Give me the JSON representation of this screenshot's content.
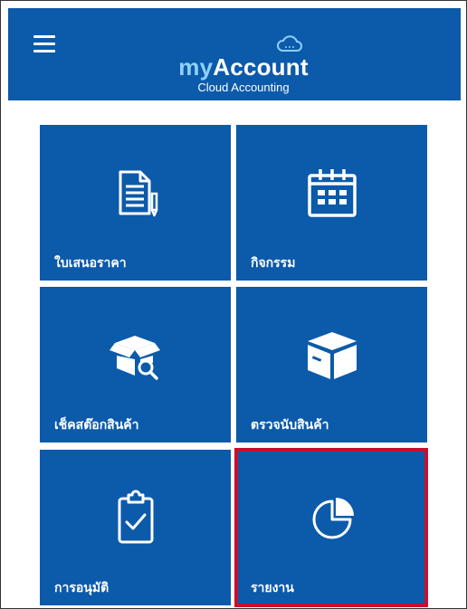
{
  "header": {
    "menu_icon": "hamburger-menu-icon",
    "logo_cloud_icon": "cloud-icon",
    "logo_prefix": "my",
    "logo_suffix": "Account",
    "logo_subtitle": "Cloud Accounting"
  },
  "tiles": [
    {
      "label": "ใบเสนอราคา",
      "icon": "document-edit-icon"
    },
    {
      "label": "กิจกรรม",
      "icon": "calendar-icon"
    },
    {
      "label": "เช็คสต๊อกสินค้า",
      "icon": "box-search-icon"
    },
    {
      "label": "ตรวจนับสินค้า",
      "icon": "box-icon"
    },
    {
      "label": "การอนุมัติ",
      "icon": "clipboard-check-icon"
    },
    {
      "label": "รายงาน",
      "icon": "pie-chart-icon"
    }
  ],
  "colors": {
    "primary": "#0c5aaa",
    "highlight_border": "#c8102e",
    "logo_accent": "#8fd0ff"
  }
}
